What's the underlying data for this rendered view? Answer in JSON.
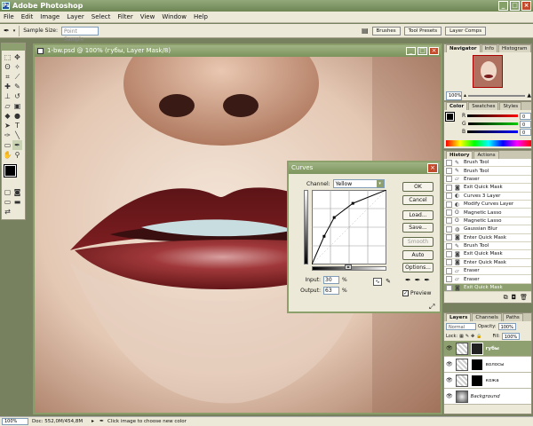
{
  "app": {
    "title": "Adobe Photoshop",
    "logo": "Ps",
    "window_buttons": [
      "_",
      "□",
      "×"
    ]
  },
  "menu": [
    "File",
    "Edit",
    "Image",
    "Layer",
    "Select",
    "Filter",
    "View",
    "Window",
    "Help"
  ],
  "options": {
    "sample_size_label": "Sample Size:",
    "sample_size_value": "Point Sample",
    "tabs": [
      "Brushes",
      "Tool Presets",
      "Layer Comps"
    ]
  },
  "document": {
    "title": "1-bw.psd @ 100% (губы, Layer Mask/8)"
  },
  "navigator": {
    "tabs": [
      "Navigator",
      "Info",
      "Histogram"
    ],
    "zoom": "100%"
  },
  "color": {
    "tabs": [
      "Color",
      "Swatches",
      "Styles"
    ],
    "channels": [
      {
        "name": "R",
        "value": "0",
        "color": "#d33"
      },
      {
        "name": "G",
        "value": "0",
        "color": "#2a2"
      },
      {
        "name": "B",
        "value": "0",
        "color": "#33d"
      }
    ]
  },
  "history": {
    "tabs": [
      "History",
      "Actions"
    ],
    "items": [
      "Brush Tool",
      "Brush Tool",
      "Eraser",
      "Exit Quick Mask",
      "Curves 3 Layer",
      "Modify Curves Layer",
      "Magnetic Lasso",
      "Magnetic Lasso",
      "Gaussian Blur",
      "Enter Quick Mask",
      "Brush Tool",
      "Exit Quick Mask",
      "Enter Quick Mask",
      "Eraser",
      "Eraser",
      "Exit Quick Mask"
    ],
    "selected_index": 15
  },
  "layers": {
    "tabs": [
      "Layers",
      "Channels",
      "Paths"
    ],
    "blend_mode": "Normal",
    "opacity_label": "Opacity:",
    "opacity": "100%",
    "lock_label": "Lock:",
    "fill_label": "Fill:",
    "fill": "100%",
    "items": [
      {
        "name": "губы",
        "selected": true
      },
      {
        "name": "волосы",
        "selected": false
      },
      {
        "name": "кожа",
        "selected": false
      },
      {
        "name": "Background",
        "selected": false
      }
    ]
  },
  "curves": {
    "title": "Curves",
    "channel_label": "Channel:",
    "channel_value": "Yellow",
    "input_label": "Input:",
    "input_value": "30",
    "output_label": "Output:",
    "output_value": "63",
    "percent": "%",
    "buttons": [
      "OK",
      "Cancel",
      "Load...",
      "Save...",
      "Smooth",
      "Auto",
      "Options..."
    ],
    "preview_label": "Preview",
    "preview_checked": true
  },
  "status": {
    "zoom": "100%",
    "doc": "Doc: 552,0M/454,8M",
    "hint": "Click image to choose new color"
  },
  "colors": {
    "chrome_olive": "#8ea070",
    "panel_bg": "#ece9d8",
    "lip_red": "#7a1b1d"
  }
}
